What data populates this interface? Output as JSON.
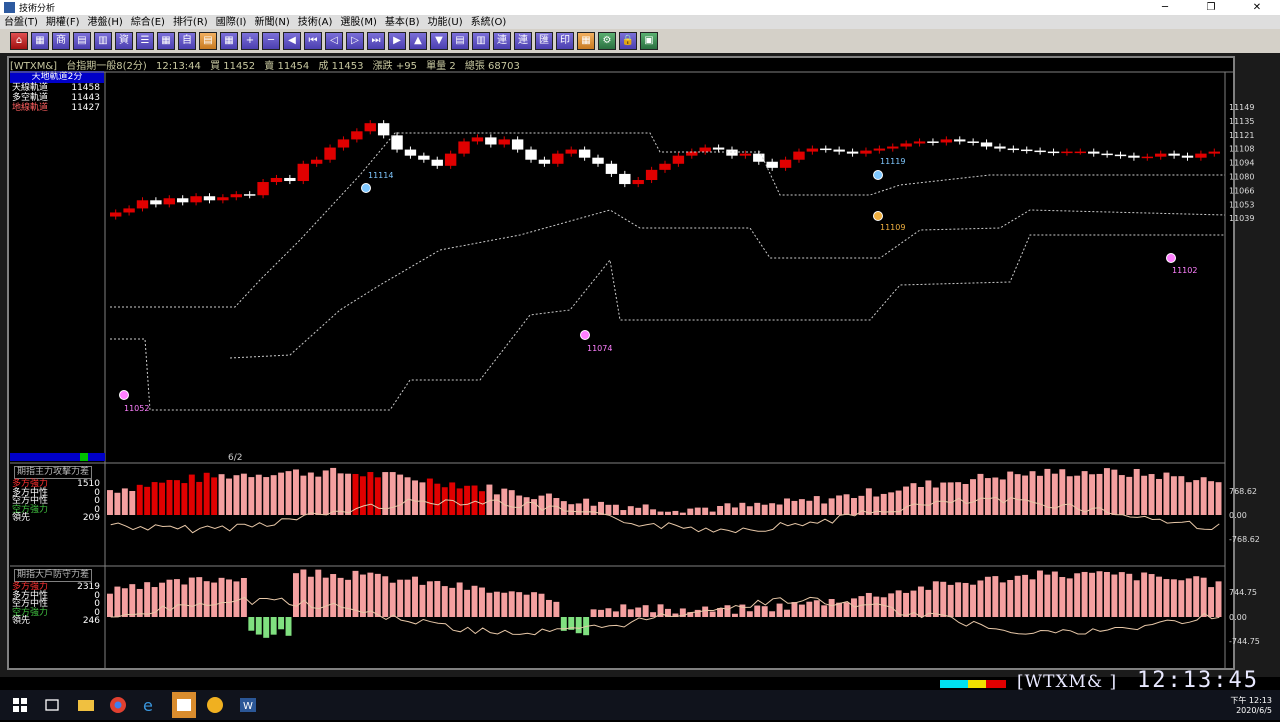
{
  "window": {
    "title": "技術分析",
    "min": "─",
    "max": "❐",
    "close": "✕"
  },
  "menu": [
    "台盤(T)",
    "期權(F)",
    "港盤(H)",
    "綜合(E)",
    "排行(R)",
    "國際(I)",
    "新聞(N)",
    "技術(A)",
    "選股(M)",
    "基本(B)",
    "功能(U)",
    "系統(O)"
  ],
  "toolbar": {
    "buttons": [
      {
        "icon": "home-icon",
        "glyph": "⌂",
        "color": "red"
      },
      {
        "icon": "grid-icon",
        "glyph": "▦",
        "color": "purple"
      },
      {
        "icon": "shop-icon",
        "glyph": "商",
        "color": "purple"
      },
      {
        "icon": "table-icon",
        "glyph": "▤",
        "color": "purple"
      },
      {
        "icon": "chart-icon",
        "glyph": "▥",
        "color": "purple"
      },
      {
        "icon": "capital-icon",
        "glyph": "資",
        "color": "purple"
      },
      {
        "icon": "list-icon",
        "glyph": "☰",
        "color": "purple"
      },
      {
        "icon": "table2-icon",
        "glyph": "▦",
        "color": "purple"
      },
      {
        "icon": "self-icon",
        "glyph": "自",
        "color": "purple"
      },
      {
        "icon": "note-icon",
        "glyph": "▤",
        "color": "orange"
      },
      {
        "icon": "calc-icon",
        "glyph": "▦",
        "color": "purple"
      },
      {
        "icon": "plus-icon",
        "glyph": "+",
        "color": "purple"
      },
      {
        "icon": "minus-icon",
        "glyph": "─",
        "color": "purple"
      },
      {
        "icon": "left-icon",
        "glyph": "◀",
        "color": "purple"
      },
      {
        "icon": "first-icon",
        "glyph": "⏮",
        "color": "purple"
      },
      {
        "icon": "prev-icon",
        "glyph": "◁",
        "color": "purple"
      },
      {
        "icon": "next-icon",
        "glyph": "▷",
        "color": "purple"
      },
      {
        "icon": "last-icon",
        "glyph": "⏭",
        "color": "purple"
      },
      {
        "icon": "right-icon",
        "glyph": "▶",
        "color": "purple"
      },
      {
        "icon": "up-icon",
        "glyph": "▲",
        "color": "purple"
      },
      {
        "icon": "down-icon",
        "glyph": "▼",
        "color": "purple"
      },
      {
        "icon": "doc-icon",
        "glyph": "▤",
        "color": "purple"
      },
      {
        "icon": "doc2-icon",
        "glyph": "▥",
        "color": "purple"
      },
      {
        "icon": "link-icon",
        "glyph": "連",
        "color": "purple"
      },
      {
        "icon": "link2-icon",
        "glyph": "連",
        "color": "purple"
      },
      {
        "icon": "exchange-icon",
        "glyph": "匯",
        "color": "purple"
      },
      {
        "icon": "print-icon",
        "glyph": "印",
        "color": "purple"
      },
      {
        "icon": "image-icon",
        "glyph": "▦",
        "color": "orange"
      },
      {
        "icon": "settings-icon",
        "glyph": "⚙",
        "color": "green"
      },
      {
        "icon": "lock-icon",
        "glyph": "🔒",
        "color": "purple"
      },
      {
        "icon": "monitor-icon",
        "glyph": "▣",
        "color": "green"
      }
    ]
  },
  "info": {
    "symbol": "[WTXM&]",
    "name": "台指期一般8(2分)",
    "time": "12:13:44",
    "buy": "買 11452",
    "sell": "賣 11454",
    "deal": "成 11453",
    "change": "漲跌 +95",
    "single_vol": "單量 2",
    "total_vol": "總張 68703"
  },
  "main_legend": {
    "title": "天地軌道2分",
    "rows": [
      {
        "label": "天線軌道",
        "value": "11458",
        "color": "#ffffff"
      },
      {
        "label": "多空軌道",
        "value": "11443",
        "color": "#ffffff"
      },
      {
        "label": "地線軌道",
        "value": "11427",
        "color": "#ff6060"
      }
    ]
  },
  "date_label": "6/2",
  "y_axis_labels": [
    "11149",
    "11135",
    "11121",
    "11108",
    "11094",
    "11080",
    "11066",
    "11053",
    "11039"
  ],
  "annotations": [
    "11114",
    "11052",
    "11074",
    "11119",
    "11109",
    "11102"
  ],
  "sub1": {
    "title": "期指主力攻擊力差",
    "rows": [
      {
        "label": "多方強力",
        "value": "1510",
        "color": "#ff3030"
      },
      {
        "label": "多方中性",
        "value": "0",
        "color": "#ffffff"
      },
      {
        "label": "空方中性",
        "value": "0",
        "color": "#ffffff"
      },
      {
        "label": "空方強力",
        "value": "0",
        "color": "#40c040"
      },
      {
        "label": "領先",
        "value": "209",
        "color": "#ffffff"
      }
    ],
    "axis": [
      "768.62",
      "0.00",
      "-768.62"
    ]
  },
  "sub2": {
    "title": "期指大戶防守力差",
    "rows": [
      {
        "label": "多方強力",
        "value": "2319",
        "color": "#ff3030"
      },
      {
        "label": "多方中性",
        "value": "0",
        "color": "#ffffff"
      },
      {
        "label": "空方中性",
        "value": "0",
        "color": "#ffffff"
      },
      {
        "label": "空方強力",
        "value": "0",
        "color": "#40c040"
      },
      {
        "label": "領先",
        "value": "246",
        "color": "#ffffff"
      }
    ],
    "axis": [
      "744.75",
      "0.00",
      "-744.75"
    ]
  },
  "status": {
    "code": "[WTXM&  ]",
    "time": "12:13:45"
  },
  "taskbar": {
    "time": "下午 12:13",
    "date": "2020/6/5"
  },
  "chart_data": {
    "type": "candlestick",
    "ylim": [
      11030,
      11160
    ],
    "close_series_hint": [
      11048,
      11052,
      11060,
      11056,
      11062,
      11058,
      11064,
      11060,
      11063,
      11066,
      11065,
      11078,
      11082,
      11079,
      11096,
      11100,
      11112,
      11120,
      11128,
      11136,
      11124,
      11110,
      11104,
      11100,
      11094,
      11106,
      11118,
      11122,
      11115,
      11120,
      11110,
      11100,
      11096,
      11106,
      11110,
      11102,
      11096,
      11086,
      11076,
      11080,
      11090,
      11096,
      11104,
      11108,
      11112,
      11110,
      11104,
      11106,
      11098,
      11092,
      11100,
      11108,
      11111,
      11110,
      11108,
      11106,
      11109,
      11111,
      11113,
      11116,
      11118,
      11117,
      11120,
      11118,
      11117,
      11113,
      11111,
      11110,
      11109,
      11108,
      11107,
      11108,
      11108,
      11106,
      11105,
      11104,
      11102,
      11103,
      11106,
      11104,
      11102,
      11106,
      11108
    ]
  }
}
